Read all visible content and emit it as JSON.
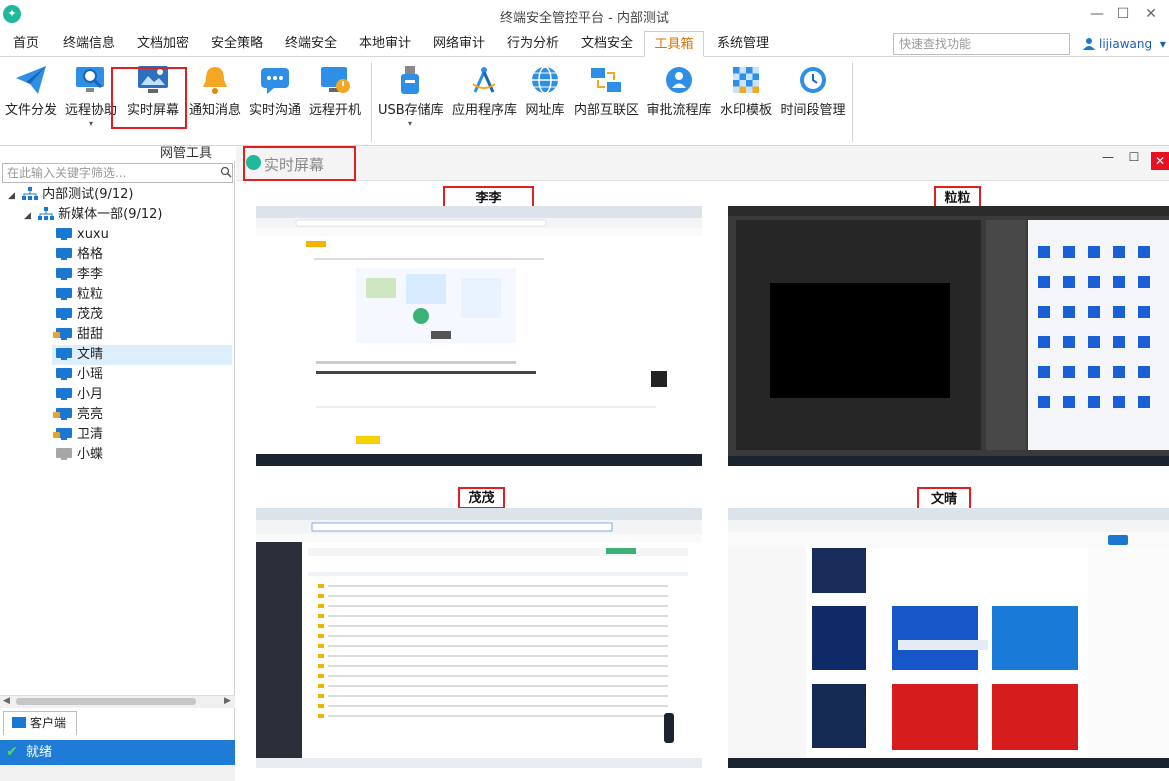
{
  "window": {
    "title": "终端安全管控平台 - 内部测试",
    "controls": [
      "—",
      "☐",
      "✕"
    ]
  },
  "menu": {
    "items": [
      "首页",
      "终端信息",
      "文档加密",
      "安全策略",
      "终端安全",
      "本地审计",
      "网络审计",
      "行为分析",
      "文档安全",
      "工具箱",
      "系统管理"
    ],
    "active": "工具箱"
  },
  "quick_search": {
    "placeholder": "快速查找功能"
  },
  "user": {
    "name": "lijiawang",
    "dropdown": "▾"
  },
  "ribbon": {
    "tools": [
      "文件分发",
      "远程协助",
      "实时屏幕",
      "通知消息",
      "实时沟通",
      "远程开机",
      "USB存储库",
      "应用程序库",
      "网址库",
      "内部互联区",
      "审批流程库",
      "水印模板",
      "时间段管理"
    ],
    "group_label": "网管工具"
  },
  "tree": {
    "search_placeholder": "在此输入关键字筛选...",
    "root": "内部测试(9/12)",
    "group": "新媒体一部(9/12)",
    "nodes": [
      {
        "name": "xuxu",
        "state": "online"
      },
      {
        "name": "格格",
        "state": "online"
      },
      {
        "name": "李李",
        "state": "online"
      },
      {
        "name": "粒粒",
        "state": "online"
      },
      {
        "name": "茂茂",
        "state": "online"
      },
      {
        "name": "甜甜",
        "state": "locked"
      },
      {
        "name": "文晴",
        "state": "online"
      },
      {
        "name": "小瑶",
        "state": "online"
      },
      {
        "name": "小月",
        "state": "online"
      },
      {
        "name": "亮亮",
        "state": "locked"
      },
      {
        "name": "卫清",
        "state": "locked"
      },
      {
        "name": "小蝶",
        "state": "offline"
      }
    ],
    "selected": "文晴"
  },
  "client_tab": "客户端",
  "status": "就绪",
  "realtime": {
    "title": "实时屏幕",
    "screens": [
      {
        "name": "李李"
      },
      {
        "name": "粒粒"
      },
      {
        "name": "茂茂"
      },
      {
        "name": "文晴"
      }
    ]
  }
}
